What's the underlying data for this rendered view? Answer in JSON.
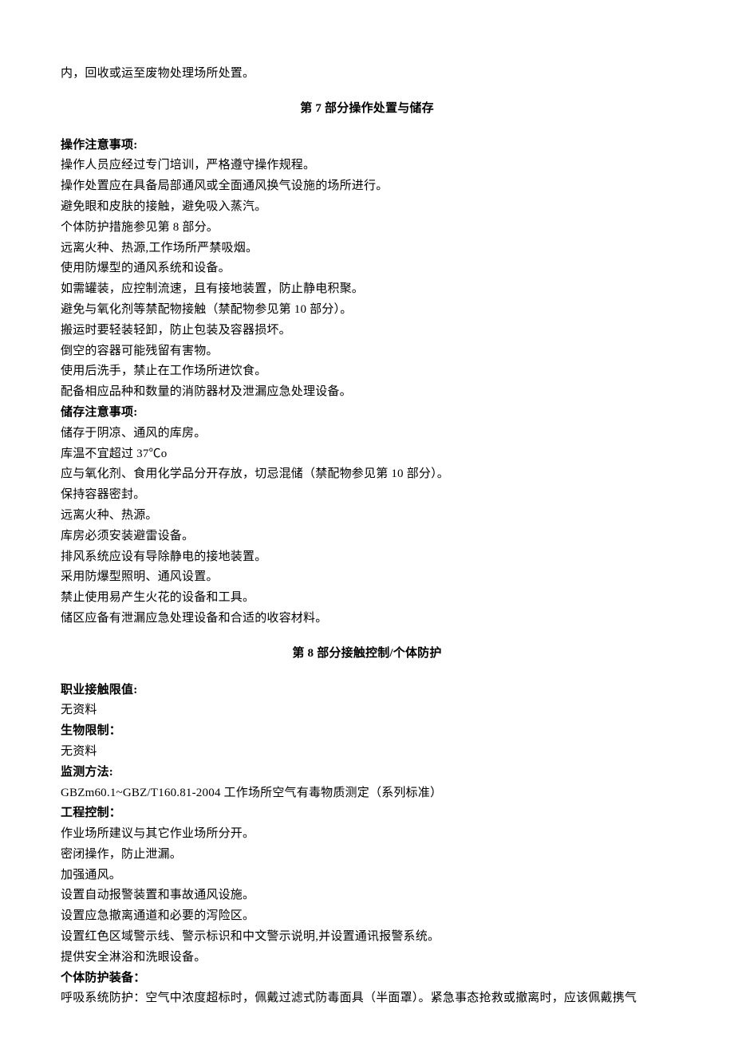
{
  "intro_line": "内，回收或运至废物处理场所处置。",
  "section7": {
    "heading": "第 7 部分操作处置与储存",
    "ops_label": "操作注意事项:",
    "ops": [
      "操作人员应经过专门培训，严格遵守操作规程。",
      "操作处置应在具备局部通风或全面通风换气设施的场所进行。",
      "避免眼和皮肤的接触，避免吸入蒸汽。",
      "个体防护措施参见第 8 部分。",
      "远离火种、热源,工作场所严禁吸烟。",
      "使用防爆型的通风系统和设备。",
      "如需罐装，应控制流速，且有接地装置，防止静电积聚。",
      "避免与氧化剂等禁配物接触（禁配物参见第 10 部分）。",
      "搬运时要轻装轻卸，防止包装及容器损坏。",
      "倒空的容器可能残留有害物。",
      "使用后洗手，禁止在工作场所进饮食。",
      "配备相应品种和数量的消防器材及泄漏应急处理设备。"
    ],
    "storage_label": "储存注意事项:",
    "storage": [
      "储存于阴凉、通风的库房。",
      "库温不宜超过 37℃o",
      "应与氧化剂、食用化学品分开存放，切忌混储（禁配物参见第 10 部分）。",
      "保持容器密封。",
      "远离火种、热源。",
      "库房必须安装避雷设备。",
      "排风系统应设有导除静电的接地装置。",
      "采用防爆型照明、通风设置。",
      "禁止使用易产生火花的设备和工具。",
      "储区应备有泄漏应急处理设备和合适的收容材料。"
    ]
  },
  "section8": {
    "heading": "第 8 部分接触控制/个体防护",
    "limit_label": "职业接触限值:",
    "limit_value": "无资料",
    "bio_label": "生物限制：",
    "bio_value": "无资料",
    "monitor_label": "监测方法:",
    "monitor_value": "GBZm60.1~GBZ/T160.81-2004 工作场所空气有毒物质测定（系列标准）",
    "eng_label": "工程控制：",
    "eng_lines": [
      "作业场所建议与其它作业场所分开。",
      "密闭操作，防止泄漏。",
      "加强通风。",
      "设置自动报警装置和事故通风设施。",
      "设置应急撤离通道和必要的泻险区。",
      "设置红色区域警示线、警示标识和中文警示说明,并设置通讯报警系统。",
      "提供安全淋浴和洗眼设备。"
    ],
    "ppe_label": "个体防护装备：",
    "ppe_line": "呼吸系统防护：空气中浓度超标时，佩戴过滤式防毒面具（半面罩）。紧急事态抢救或撤离时，应该佩戴携气"
  }
}
